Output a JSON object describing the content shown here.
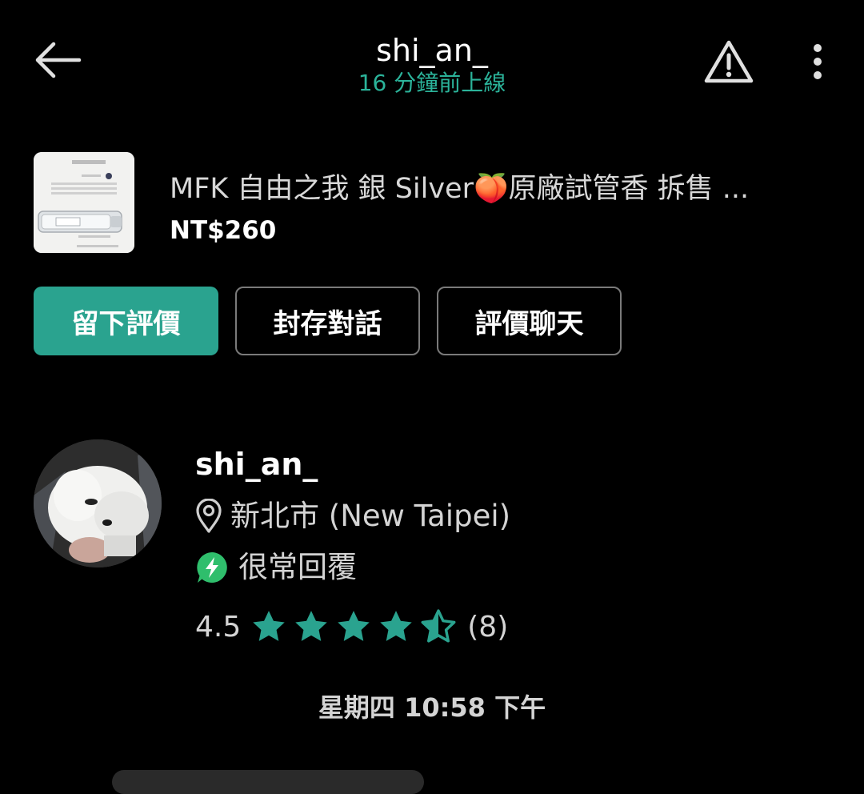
{
  "header": {
    "title": "shi_an_",
    "subtitle": "16 分鐘前上線"
  },
  "listing": {
    "title": "MFK 自由之我 銀 Silver🍑原廠試管香 拆售 ...",
    "price": "NT$260"
  },
  "actions": {
    "leave_review": "留下評價",
    "archive_chat": "封存對話",
    "review_chat": "評價聊天"
  },
  "profile": {
    "name": "shi_an_",
    "location": "新北市 (New Taipei)",
    "response": "很常回覆",
    "rating": "4.5",
    "rating_count": "(8)",
    "stars_value": 4.5,
    "stars_max": 5
  },
  "timestamp": "星期四 10:58 下午",
  "colors": {
    "accent": "#2aa38f",
    "subtitle": "#2bb39a",
    "star": "#2aa38f",
    "badge": "#2fbe6c"
  }
}
